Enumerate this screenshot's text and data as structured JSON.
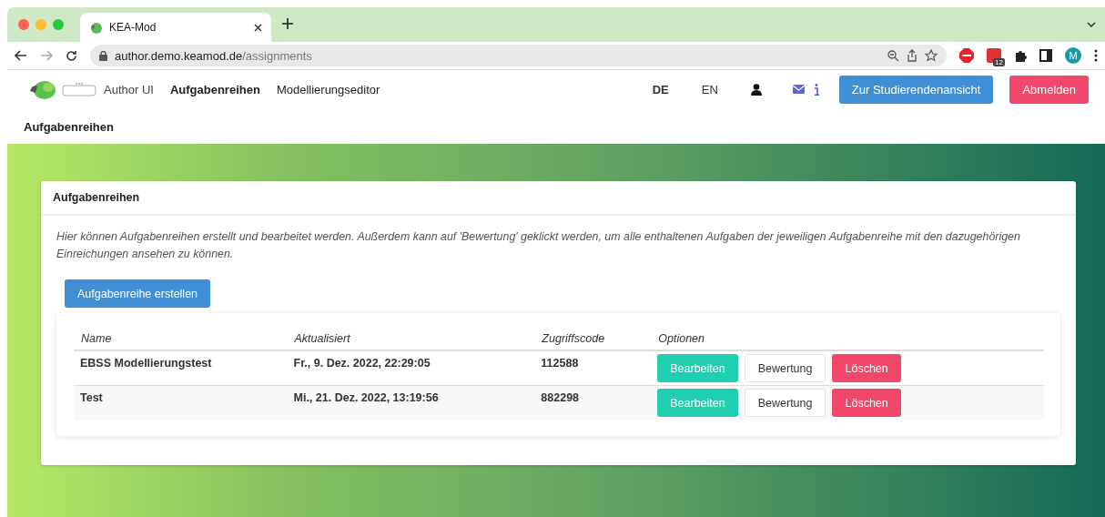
{
  "browser": {
    "tab_title": "KEA-Mod",
    "url_host": "author.demo.keamod.de",
    "url_path": "/assignments",
    "extension_badge": "12",
    "profile_initial": "M"
  },
  "nav": {
    "brand": "Author UI",
    "links": [
      {
        "label": "Aufgabenreihen",
        "selected": true
      },
      {
        "label": "Modellierungseditor",
        "selected": false
      }
    ],
    "languages": [
      {
        "label": "DE",
        "selected": true
      },
      {
        "label": "EN",
        "selected": false
      }
    ],
    "buttons": [
      {
        "label": "Zur Studierendenansicht",
        "kind": "primary"
      },
      {
        "label": "Abmelden",
        "kind": "danger"
      }
    ]
  },
  "breadcrumb": "Aufgabenreihen",
  "card": {
    "title": "Aufgabenreihen",
    "description": "Hier können Aufgabenreihen erstellt und bearbeitet werden. Außerdem kann auf 'Bewertung' geklickt werden, um alle enthaltenen Aufgaben der jeweiligen Aufgabenreihe mit den dazugehörigen Einreichungen ansehen zu können.",
    "create_button": "Aufgabenreihe erstellen",
    "table": {
      "columns": [
        "Name",
        "Aktualisiert",
        "Zugriffscode",
        "Optionen"
      ],
      "rows": [
        {
          "name": "EBSS Modellierungstest",
          "updated": "Fr., 9. Dez. 2022, 22:29:05",
          "code": "112588",
          "actions": [
            {
              "label": "Bearbeiten",
              "kind": "success"
            },
            {
              "label": "Bewertung",
              "kind": "light"
            },
            {
              "label": "Löschen",
              "kind": "danger"
            }
          ]
        },
        {
          "name": "Test",
          "updated": "Mi., 21. Dez. 2022, 13:19:56",
          "code": "882298",
          "actions": [
            {
              "label": "Bearbeiten",
              "kind": "success"
            },
            {
              "label": "Bewertung",
              "kind": "light"
            },
            {
              "label": "Löschen",
              "kind": "danger"
            }
          ]
        }
      ]
    }
  }
}
